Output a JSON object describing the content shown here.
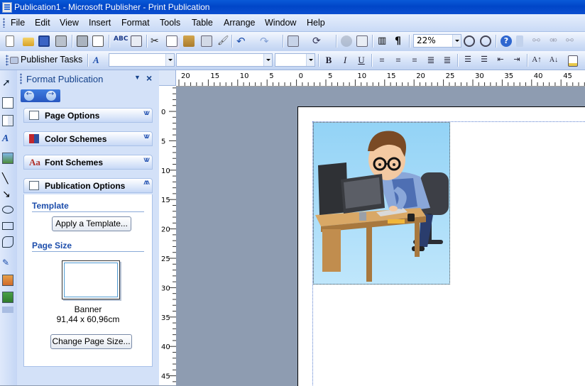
{
  "window": {
    "title": "Publication1 - Microsoft Publisher - Print Publication"
  },
  "menu": [
    "File",
    "Edit",
    "View",
    "Insert",
    "Format",
    "Tools",
    "Table",
    "Arrange",
    "Window",
    "Help"
  ],
  "toolbar": {
    "zoom_value": "22%",
    "publisher_tasks_label": "Publisher Tasks",
    "style_value": "",
    "font_value": "",
    "size_value": ""
  },
  "task_pane": {
    "title": "Format Publication",
    "sections": [
      "Page Options",
      "Color Schemes",
      "Font Schemes",
      "Publication Options"
    ],
    "template_heading": "Template",
    "apply_template_button": "Apply a Template...",
    "page_size_heading": "Page Size",
    "page_size_name": "Banner",
    "page_size_dims": "91,44 x 60,96cm",
    "change_page_size_button": "Change Page Size..."
  },
  "rulers": {
    "horizontal_labels": [
      "20",
      "15",
      "10",
      "5",
      "0",
      "5",
      "10",
      "15",
      "20",
      "25",
      "30",
      "35",
      "40",
      "45"
    ],
    "vertical_labels": [
      "0",
      "5",
      "10",
      "15",
      "20",
      "25",
      "30",
      "35",
      "40",
      "45"
    ]
  },
  "colors": {
    "titlebar": "#0a59d8",
    "taskpane_bg": "#d3e1f8",
    "heading_blue": "#1c4dab",
    "workspace": "#8e9cb1"
  },
  "icons": {
    "toolbar1": [
      "new-icon",
      "open-icon",
      "save-icon",
      "print-setup-icon",
      "print-icon",
      "print-preview-icon",
      "spelling-icon",
      "research-icon",
      "cut-icon",
      "copy-icon",
      "paste-icon",
      "format-painter-icon",
      "undo-icon",
      "redo-icon",
      "bring-forward-icon",
      "rotate-icon",
      "zoom-icon",
      "zoom-out-icon",
      "zoom-in-icon",
      "help-icon"
    ],
    "toolbar2": [
      "styles-icon",
      "bold-icon",
      "italic-icon",
      "underline-icon",
      "align-left-icon",
      "center-icon",
      "align-right-icon",
      "justify-icon",
      "distribute-icon",
      "numbering-icon",
      "bullets-icon",
      "decrease-indent-icon",
      "increase-indent-icon",
      "grow-font-icon",
      "shrink-font-icon",
      "fill-color-icon"
    ]
  }
}
